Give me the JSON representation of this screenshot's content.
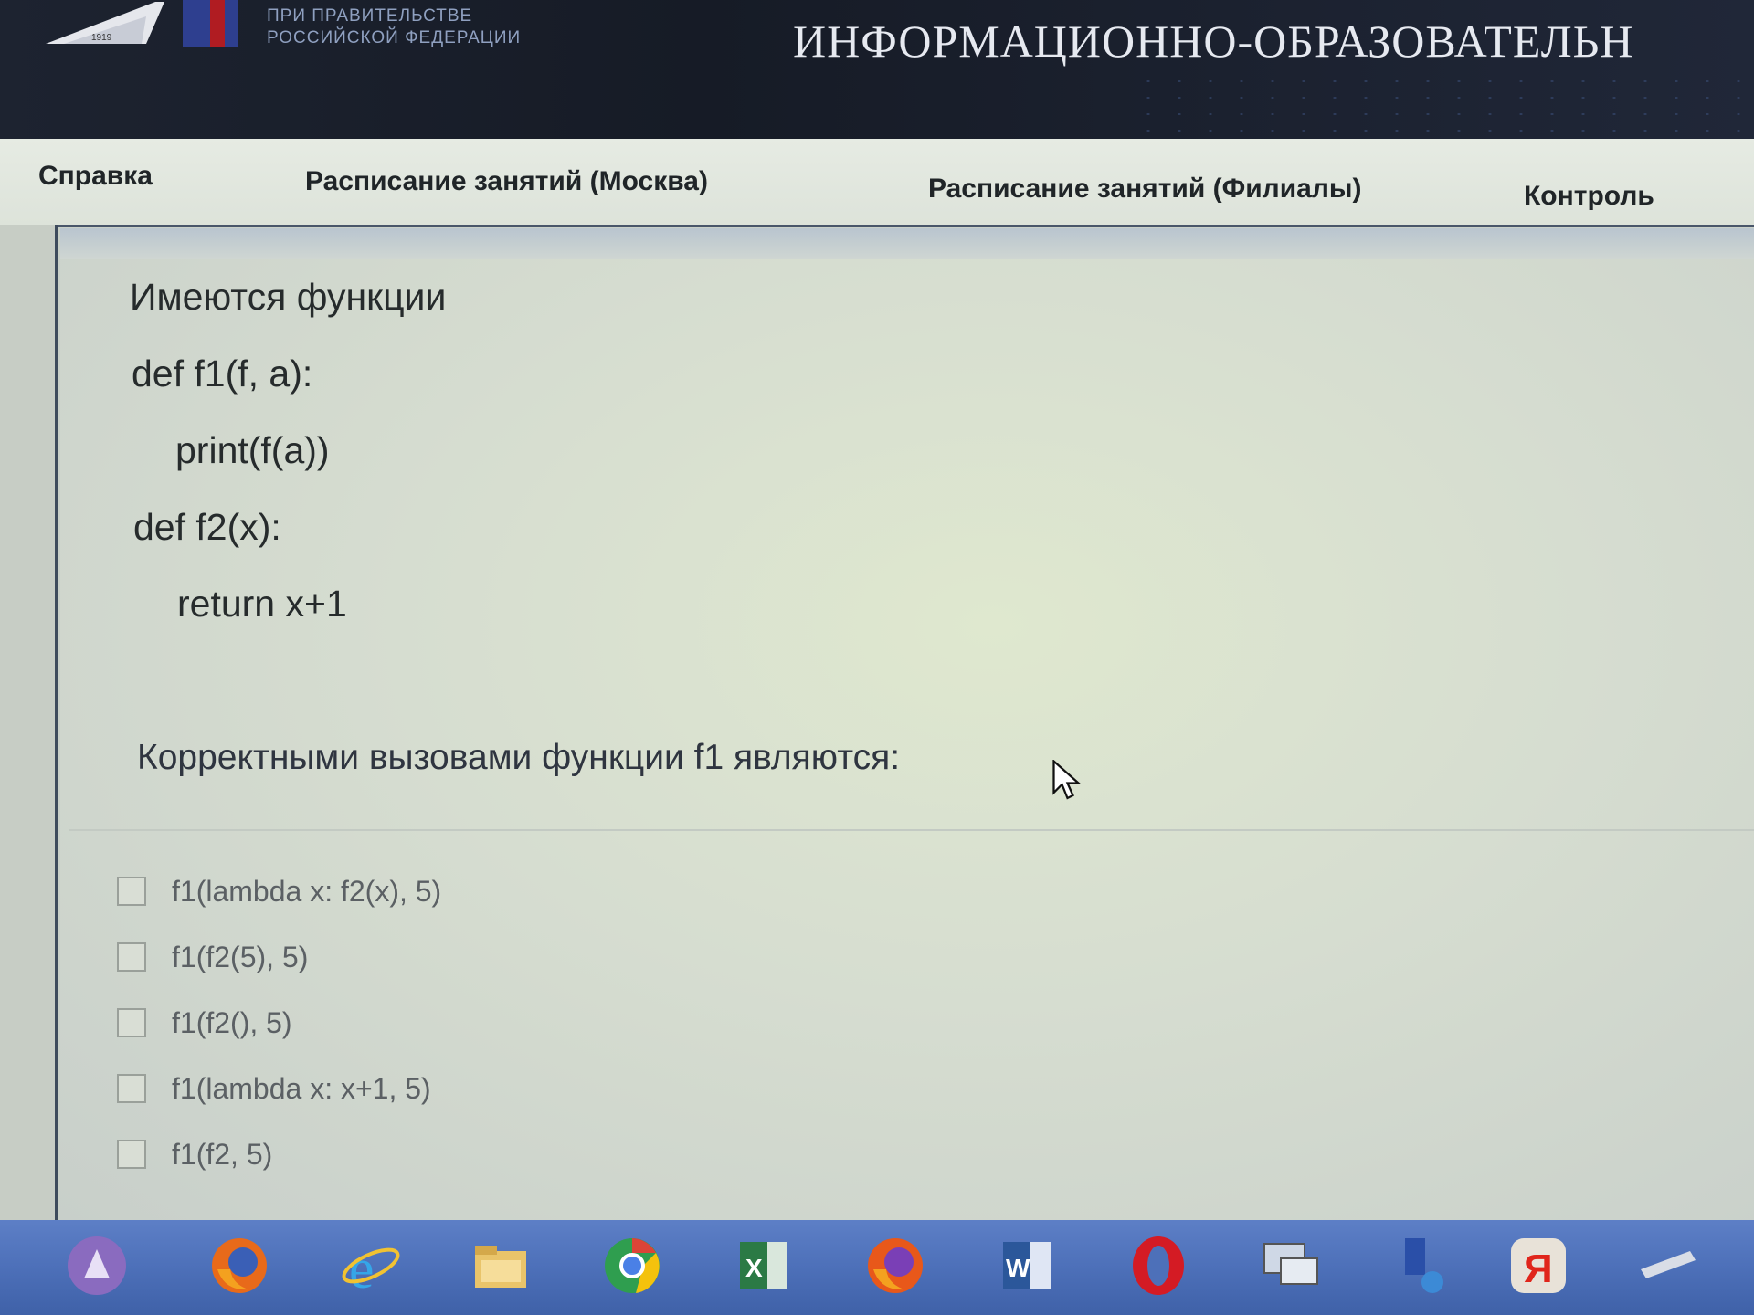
{
  "header": {
    "univ_line1": "ПРИ ПРАВИТЕЛЬСТВЕ",
    "univ_line2": "РОССИЙСКОЙ ФЕДЕРАЦИИ",
    "logo_year": "1919",
    "portal_title": "ИНФОРМАЦИОННО-ОБРАЗОВАТЕЛЬН"
  },
  "nav": {
    "items": [
      {
        "label": "Справка"
      },
      {
        "label": "Расписание занятий (Москва)"
      },
      {
        "label": "Расписание занятий (Филиалы)"
      },
      {
        "label": "Контроль"
      }
    ]
  },
  "question": {
    "intro": "Имеются функции",
    "code": [
      "def f1(f, a):",
      "print(f(a))",
      "def f2(x):",
      "return x+1"
    ],
    "prompt": "Корректными вызовами функции f1 являются:"
  },
  "options": [
    {
      "label": "f1(lambda x: f2(x), 5)",
      "checked": false
    },
    {
      "label": "f1(f2(5), 5)",
      "checked": false
    },
    {
      "label": "f1(f2(), 5)",
      "checked": false
    },
    {
      "label": "f1(lambda x: x+1, 5)",
      "checked": false
    },
    {
      "label": "f1(f2, 5)",
      "checked": false
    }
  ],
  "taskbar": {
    "icons": [
      "start-orb-icon",
      "firefox-icon",
      "internet-explorer-icon",
      "file-explorer-icon",
      "chrome-icon",
      "excel-icon",
      "firefox-icon",
      "word-icon",
      "opera-icon",
      "remote-desktop-icon",
      "network-icon",
      "yandex-browser-icon",
      "app-icon"
    ]
  },
  "colors": {
    "header_bg": "#1d2330",
    "nav_bg": "#e3e8e0",
    "taskbar": "#4d70b9"
  }
}
